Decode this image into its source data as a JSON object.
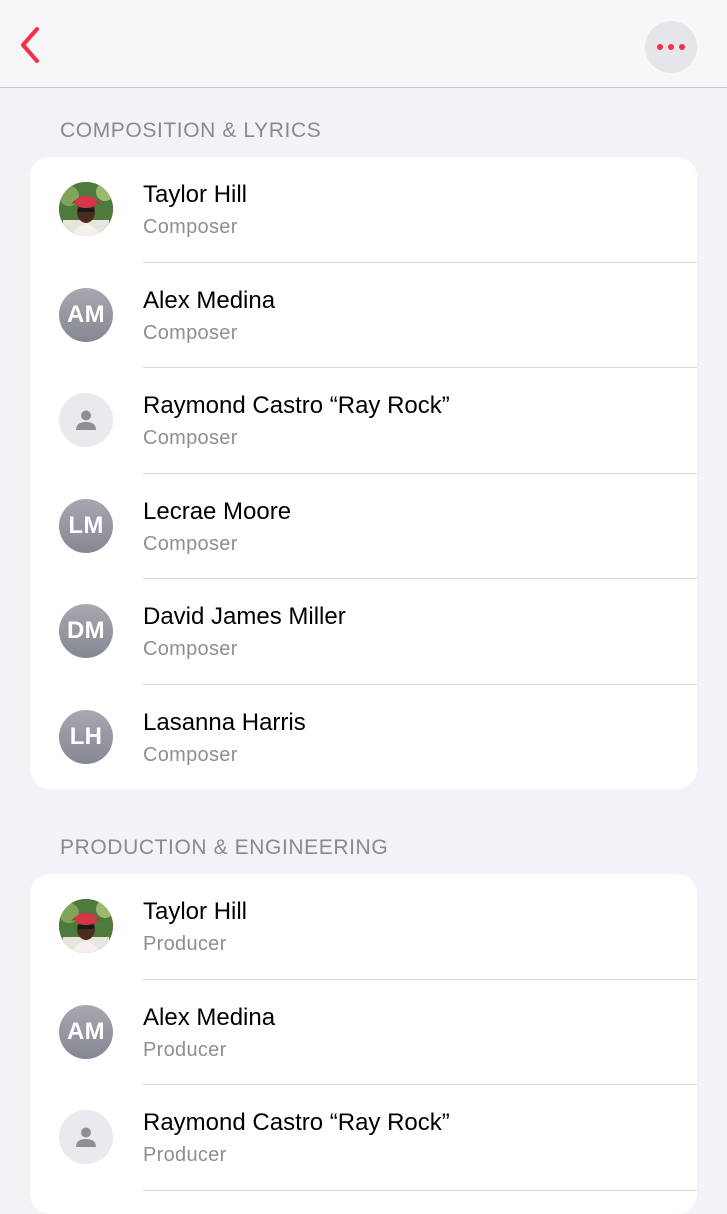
{
  "nav": {
    "back_icon": "chevron-left-icon",
    "more_icon": "ellipsis-icon",
    "accent_color": "#fa2d48"
  },
  "sections": [
    {
      "title": "COMPOSITION & LYRICS",
      "rows": [
        {
          "name": "Taylor Hill",
          "role": "Composer",
          "avatar": "photo"
        },
        {
          "name": "Alex Medina",
          "role": "Composer",
          "avatar": "initials",
          "initials": "AM"
        },
        {
          "name": "Raymond Castro “Ray Rock”",
          "role": "Composer",
          "avatar": "placeholder"
        },
        {
          "name": "Lecrae Moore",
          "role": "Composer",
          "avatar": "initials",
          "initials": "LM"
        },
        {
          "name": "David James Miller",
          "role": "Composer",
          "avatar": "initials",
          "initials": "DM"
        },
        {
          "name": "Lasanna Harris",
          "role": "Composer",
          "avatar": "initials",
          "initials": "LH"
        }
      ]
    },
    {
      "title": "PRODUCTION & ENGINEERING",
      "rows": [
        {
          "name": "Taylor Hill",
          "role": "Producer",
          "avatar": "photo"
        },
        {
          "name": "Alex Medina",
          "role": "Producer",
          "avatar": "initials",
          "initials": "AM"
        },
        {
          "name": "Raymond Castro “Ray Rock”",
          "role": "Producer",
          "avatar": "placeholder"
        }
      ]
    }
  ]
}
